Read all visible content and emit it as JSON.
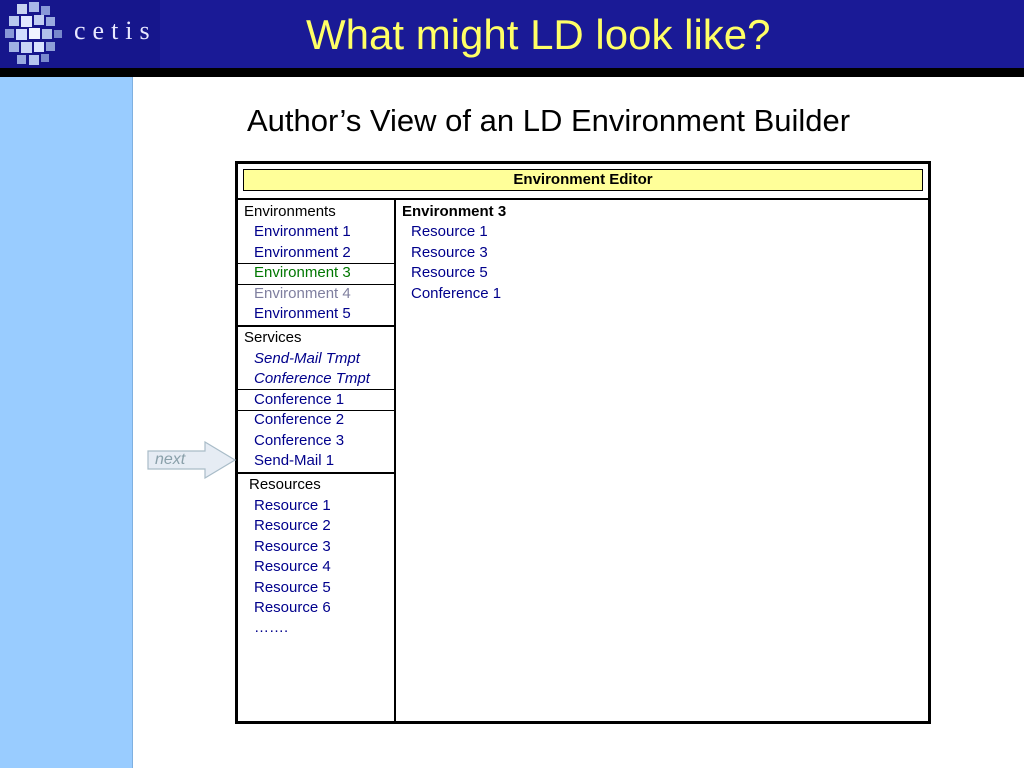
{
  "header": {
    "logo_text": "cetis",
    "title": "What might LD look like?"
  },
  "subtitle": "Author’s  View of an LD Environment Builder",
  "editor": {
    "title": "Environment Editor",
    "environments_heading": "Environments",
    "environments": [
      "Environment 1",
      "Environment 2",
      "Environment 3",
      "Environment 4",
      "Environment 5"
    ],
    "services_heading": "Services",
    "services": [
      "Send-Mail Tmpt",
      "Conference Tmpt",
      "Conference 1",
      "Conference 2",
      "Conference 3",
      "Send-Mail 1"
    ],
    "resources_heading": "Resources",
    "resources": [
      "Resource 1",
      "Resource 2",
      "Resource 3",
      "Resource 4",
      "Resource 5",
      "Resource 6",
      "……."
    ],
    "detail_heading": "Environment 3",
    "detail_items": [
      "Resource 1",
      "Resource 3",
      "Resource 5",
      "Conference 1"
    ]
  },
  "next_button": {
    "label": "next"
  },
  "colors": {
    "header_bg": "#1a1a96",
    "title_yellow": "#ffff66",
    "sidebar_blue": "#99ccff",
    "editor_title_bg": "#ffff99",
    "item_blue": "#00008b",
    "selected_green": "#007700",
    "disabled_gray": "#7f7f9f"
  }
}
